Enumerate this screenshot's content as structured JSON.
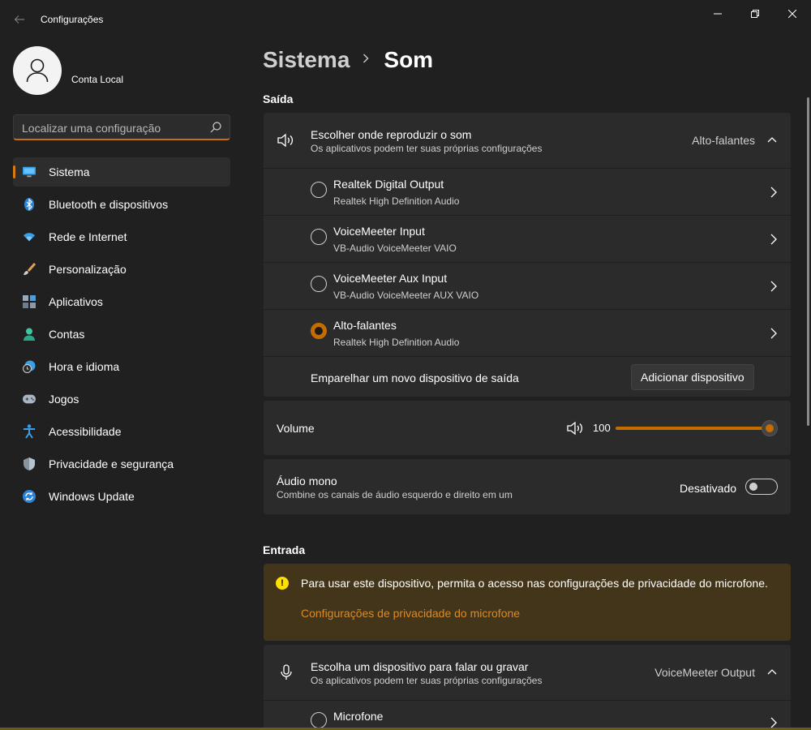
{
  "window": {
    "title": "Configurações",
    "controls": [
      "minimize-icon",
      "restore-icon",
      "close-icon"
    ]
  },
  "account": {
    "name": "Conta Local"
  },
  "search": {
    "placeholder": "Localizar uma configuração"
  },
  "sidebar": {
    "items": [
      {
        "label": "Sistema",
        "icon": "system-icon",
        "active": true
      },
      {
        "label": "Bluetooth e dispositivos",
        "icon": "bluetooth-icon"
      },
      {
        "label": "Rede e Internet",
        "icon": "wifi-icon"
      },
      {
        "label": "Personalização",
        "icon": "brush-icon"
      },
      {
        "label": "Aplicativos",
        "icon": "apps-icon"
      },
      {
        "label": "Contas",
        "icon": "person-icon"
      },
      {
        "label": "Hora e idioma",
        "icon": "globe-clock-icon"
      },
      {
        "label": "Jogos",
        "icon": "gamepad-icon"
      },
      {
        "label": "Acessibilidade",
        "icon": "accessibility-icon"
      },
      {
        "label": "Privacidade e segurança",
        "icon": "shield-icon"
      },
      {
        "label": "Windows Update",
        "icon": "update-icon"
      }
    ]
  },
  "breadcrumb": {
    "parent": "Sistema",
    "separator": ">",
    "current": "Som"
  },
  "output": {
    "section_title": "Saída",
    "chooser": {
      "title": "Escolher onde reproduzir o som",
      "subtitle": "Os aplicativos podem ter suas próprias configurações",
      "selected": "Alto-falantes"
    },
    "devices": [
      {
        "name": "Realtek Digital Output",
        "driver": "Realtek High Definition Audio",
        "checked": false
      },
      {
        "name": "VoiceMeeter Input",
        "driver": "VB-Audio VoiceMeeter VAIO",
        "checked": false
      },
      {
        "name": "VoiceMeeter Aux Input",
        "driver": "VB-Audio VoiceMeeter AUX VAIO",
        "checked": false
      },
      {
        "name": "Alto-falantes",
        "driver": "Realtek High Definition Audio",
        "checked": true
      }
    ],
    "pair": {
      "label": "Emparelhar um novo dispositivo de saída",
      "button": "Adicionar dispositivo"
    },
    "volume": {
      "label": "Volume",
      "value": "100",
      "level": 1.0
    },
    "mono": {
      "title": "Áudio mono",
      "subtitle": "Combine os canais de áudio esquerdo e direito em um",
      "state": "Desativado",
      "on": false
    }
  },
  "input": {
    "section_title": "Entrada",
    "warning": {
      "text": "Para usar este dispositivo, permita o acesso nas configurações de privacidade do microfone.",
      "link": "Configurações de privacidade do microfone"
    },
    "chooser": {
      "title": "Escolha um dispositivo para falar ou gravar",
      "subtitle": "Os aplicativos podem ter suas próprias configurações",
      "selected": "VoiceMeeter Output"
    },
    "devices": [
      {
        "name": "Microfone",
        "checked": false
      }
    ]
  },
  "colors": {
    "accent": "#c46c00",
    "background": "#202020",
    "card": "#2b2b2b",
    "warning_bg": "#433519"
  }
}
